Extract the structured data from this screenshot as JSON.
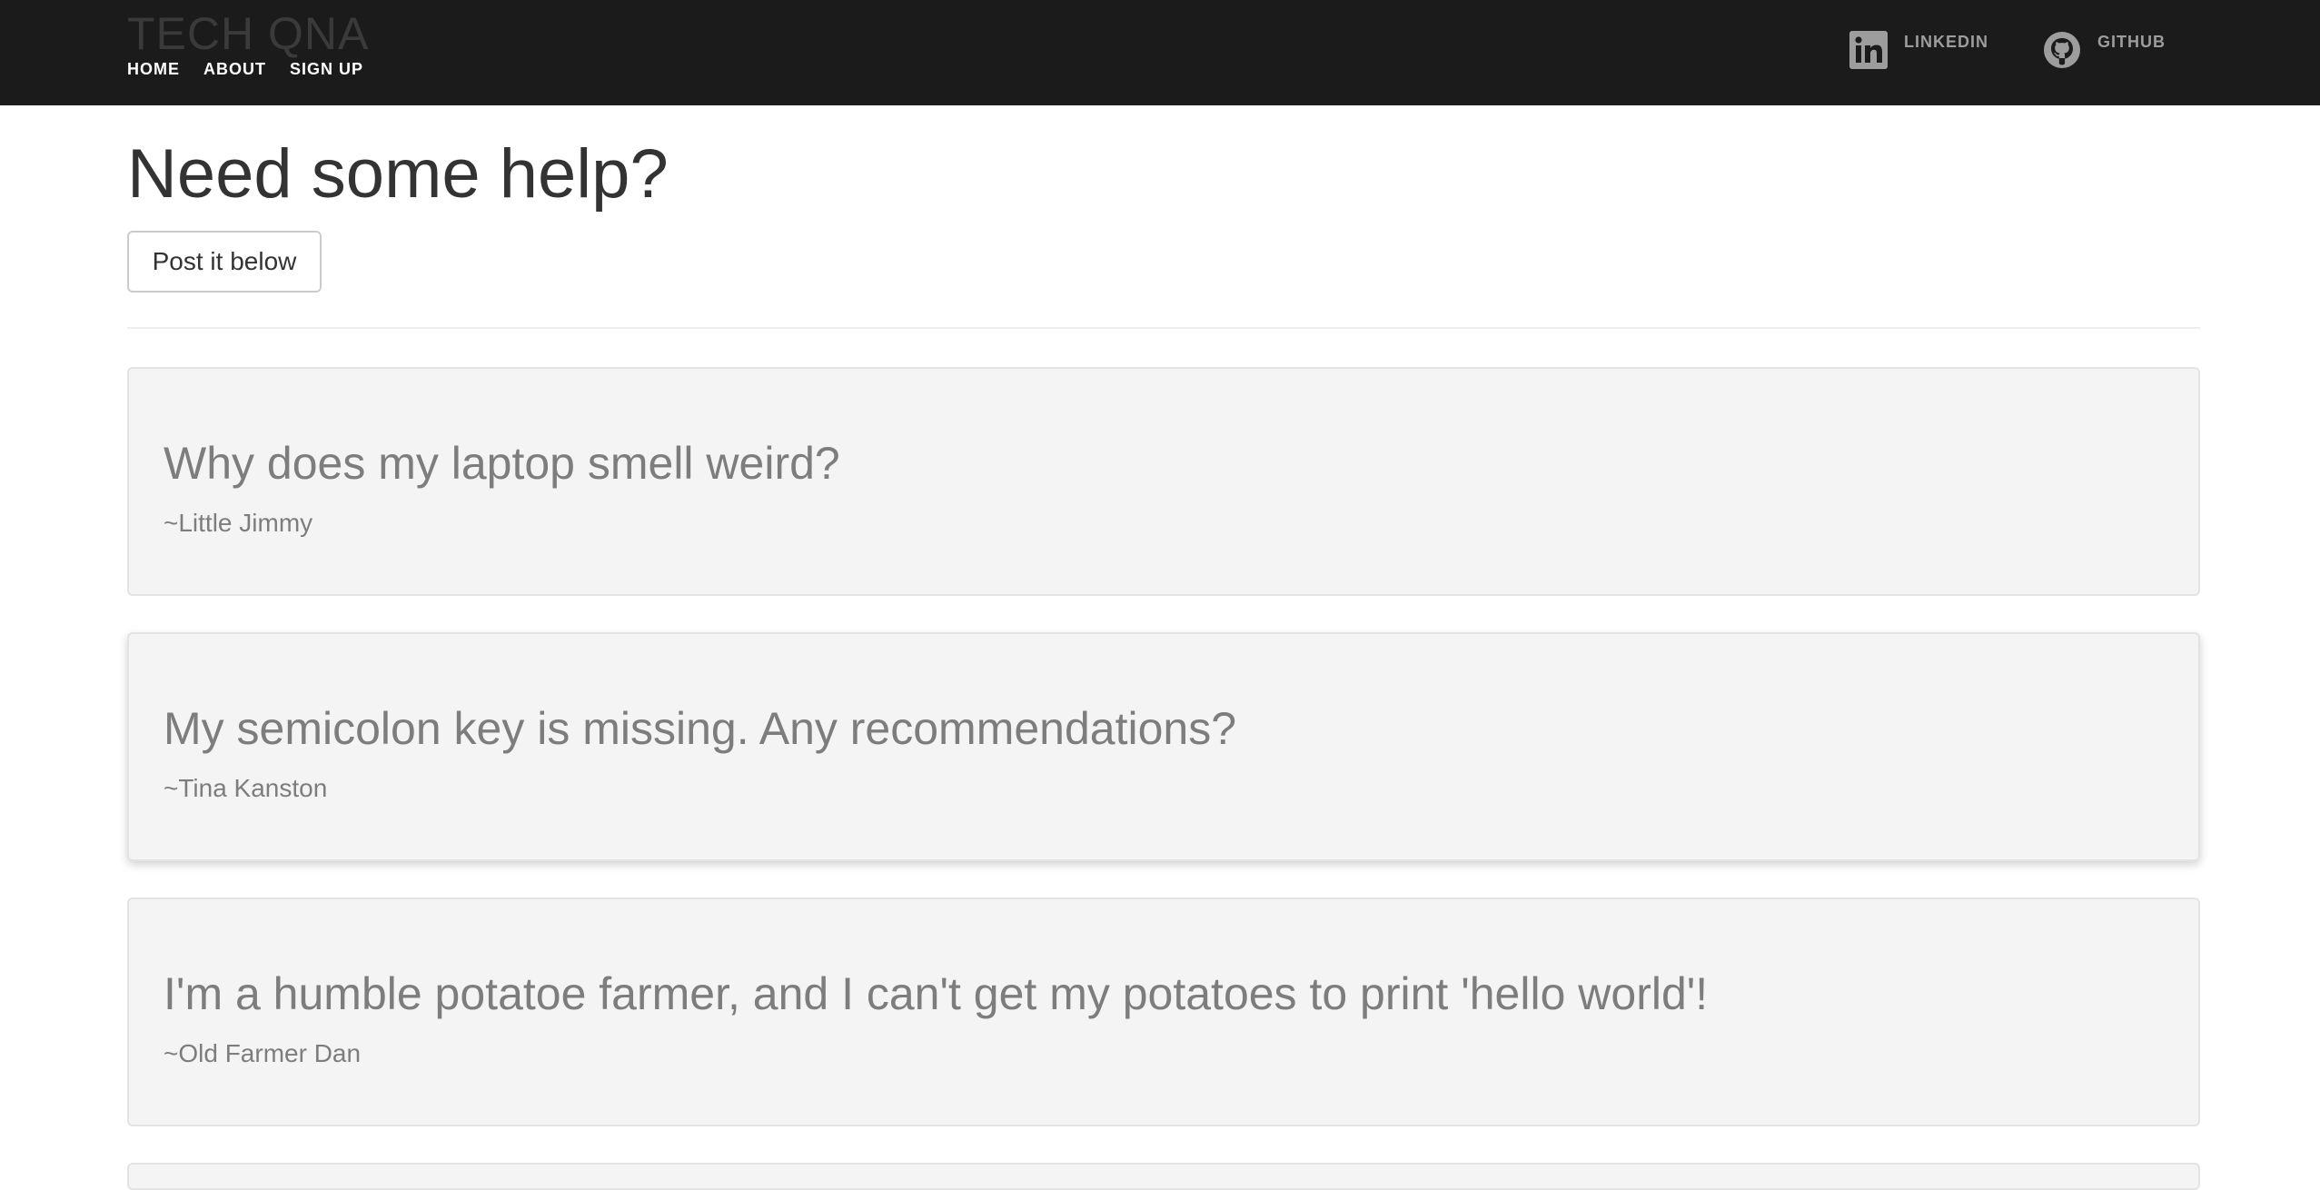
{
  "navbar": {
    "brand": "TECH QNA",
    "links": [
      "HOME",
      "ABOUT",
      "SIGN UP"
    ],
    "social": [
      {
        "label": "LINKEDIN",
        "icon": "linkedin-icon"
      },
      {
        "label": "GITHUB",
        "icon": "github-icon"
      }
    ]
  },
  "main": {
    "heading": "Need some help?",
    "post_button_label": "Post it below",
    "questions": [
      {
        "title": "Why does my laptop smell weird?",
        "author": "~Little Jimmy"
      },
      {
        "title": "My semicolon key is missing. Any recommendations?",
        "author": "~Tina Kanston"
      },
      {
        "title": "I'm a humble potatoe farmer, and I can't get my potatoes to print 'hello world'!",
        "author": "~Old Farmer Dan"
      }
    ]
  },
  "colors": {
    "navbar_bg": "#1b1b1b",
    "card_bg": "#f4f4f4",
    "card_text": "#7d7d7d",
    "heading_text": "#333333",
    "social_icon": "#9d9d9d"
  }
}
